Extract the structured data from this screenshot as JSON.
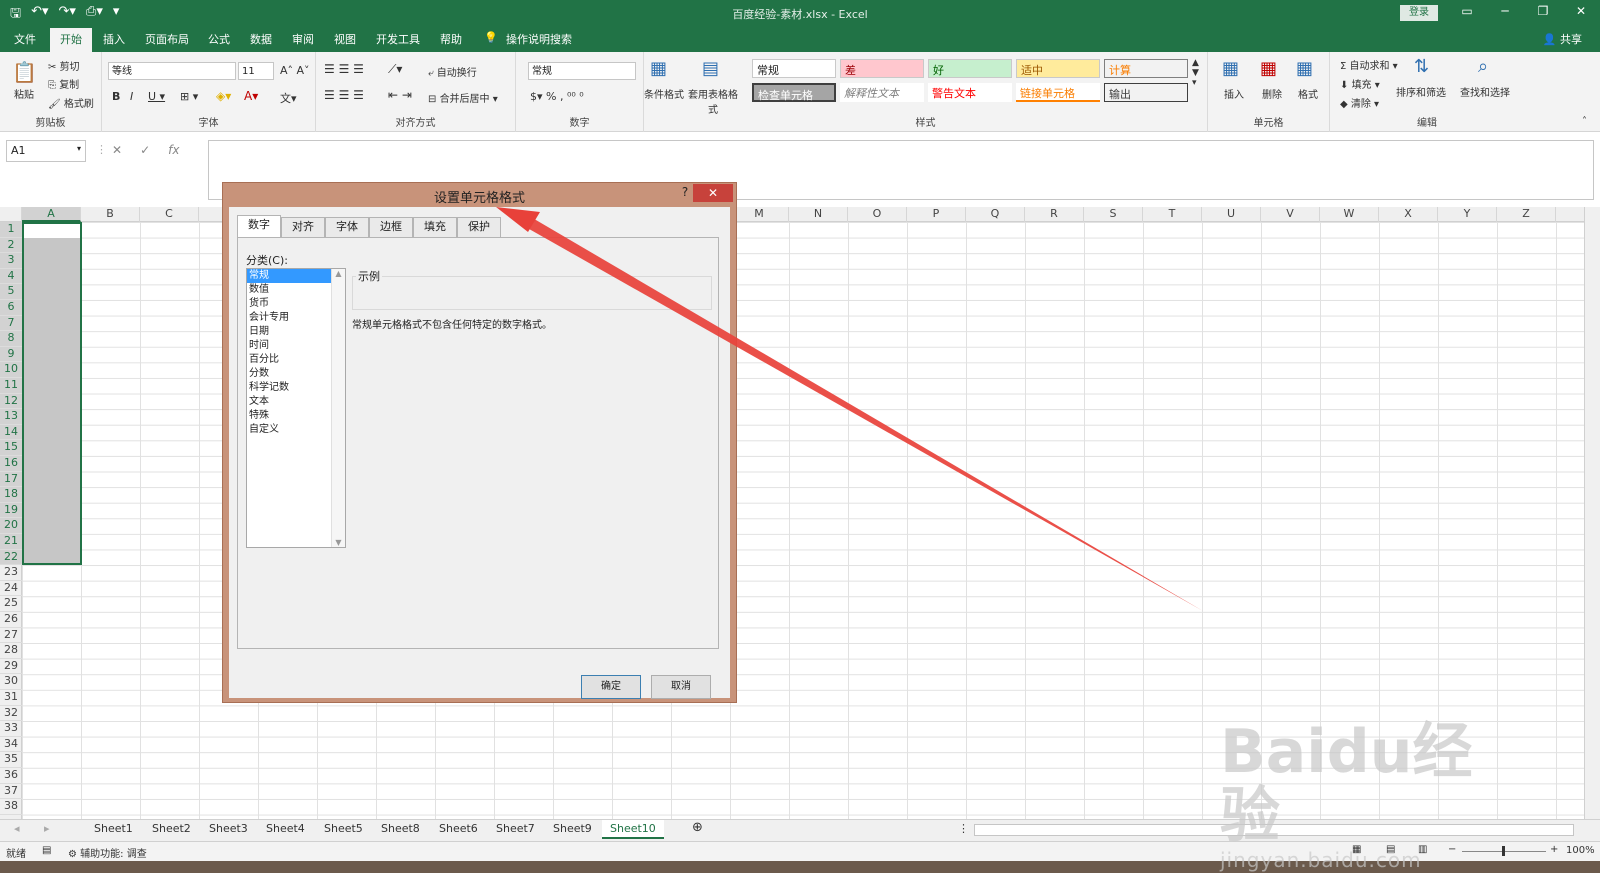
{
  "titlebar": {
    "title": "百度经验-素材.xlsx  -  Excel",
    "login": "登录"
  },
  "tabs": [
    "文件",
    "开始",
    "插入",
    "页面布局",
    "公式",
    "数据",
    "审阅",
    "视图",
    "开发工具",
    "帮助",
    "操作说明搜索"
  ],
  "share": "共享",
  "ribbon": {
    "clipboard": {
      "label": "剪贴板",
      "paste": "粘贴",
      "cut": "剪切",
      "copy": "复制",
      "format_painter": "格式刷"
    },
    "font": {
      "label": "字体",
      "name": "等线",
      "size": "11"
    },
    "alignment": {
      "label": "对齐方式",
      "wrap": "自动换行",
      "merge": "合并后居中"
    },
    "number": {
      "label": "数字",
      "format": "常规"
    },
    "styles": {
      "label": "样式",
      "cond_format": "条件格式",
      "table_format": "套用表格格式",
      "cells": [
        "常规",
        "差",
        "好",
        "适中",
        "计算",
        "检查单元格",
        "解释性文本",
        "警告文本",
        "链接单元格",
        "输出"
      ]
    },
    "cells": {
      "label": "单元格",
      "insert": "插入",
      "delete": "删除",
      "format": "格式"
    },
    "editing": {
      "label": "编辑",
      "autosum": "自动求和",
      "fill": "填充",
      "clear": "清除",
      "sort": "排序和筛选",
      "find": "查找和选择"
    }
  },
  "namebox": "A1",
  "columns": [
    "A",
    "B",
    "C",
    "D",
    "E",
    "F",
    "G",
    "H",
    "I",
    "J",
    "K",
    "L",
    "M",
    "N",
    "O",
    "P",
    "Q",
    "R",
    "S",
    "T",
    "U",
    "V",
    "W",
    "X",
    "Y",
    "Z"
  ],
  "rows": [
    "1",
    "2",
    "3",
    "4",
    "5",
    "6",
    "7",
    "8",
    "9",
    "10",
    "11",
    "12",
    "13",
    "14",
    "15",
    "16",
    "17",
    "18",
    "19",
    "20",
    "21",
    "22",
    "23",
    "24",
    "25",
    "26",
    "27",
    "28",
    "29",
    "30",
    "31",
    "32",
    "33",
    "34",
    "35",
    "36",
    "37",
    "38"
  ],
  "sheets": [
    "Sheet1",
    "Sheet2",
    "Sheet3",
    "Sheet4",
    "Sheet5",
    "Sheet8",
    "Sheet6",
    "Sheet7",
    "Sheet9",
    "Sheet10"
  ],
  "status": {
    "ready": "就绪",
    "accessibility": "辅助功能: 调查",
    "zoom": "100%"
  },
  "dialog": {
    "title": "设置单元格格式",
    "help": "?",
    "tabs": [
      "数字",
      "对齐",
      "字体",
      "边框",
      "填充",
      "保护"
    ],
    "category_label": "分类(C):",
    "categories": [
      "常规",
      "数值",
      "货币",
      "会计专用",
      "日期",
      "时间",
      "百分比",
      "分数",
      "科学记数",
      "文本",
      "特殊",
      "自定义"
    ],
    "sample_label": "示例",
    "description": "常规单元格格式不包含任何特定的数字格式。",
    "ok": "确定",
    "cancel": "取消"
  },
  "watermark": {
    "line1": "Baidu经验",
    "line2": "jingyan.baidu.com"
  },
  "colors": {
    "excel_green": "#217346",
    "arrow": "#e8413a",
    "dialog_border": "#c8937a"
  }
}
